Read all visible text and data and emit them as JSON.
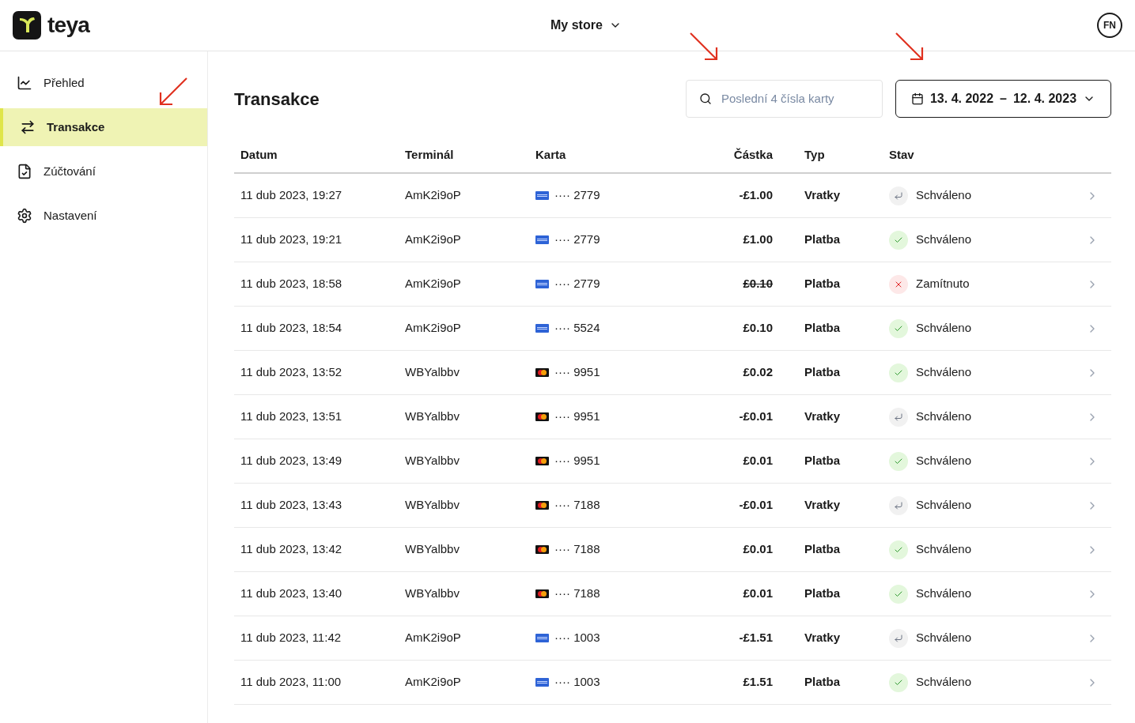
{
  "header": {
    "logo_text": "teya",
    "store": "My store",
    "avatar": "FN"
  },
  "sidebar": {
    "items": [
      {
        "label": "Přehled",
        "selected": false
      },
      {
        "label": "Transakce",
        "selected": true
      },
      {
        "label": "Zúčtování",
        "selected": false
      },
      {
        "label": "Nastavení",
        "selected": false
      }
    ]
  },
  "page": {
    "title": "Transakce",
    "search": {
      "placeholder": "Poslední 4 čísla karty"
    },
    "date_range": {
      "from": "13. 4. 2022",
      "separator": "–",
      "to": "12. 4. 2023"
    }
  },
  "table": {
    "columns": [
      "Datum",
      "Terminál",
      "Karta",
      "Částka",
      "Typ",
      "Stav"
    ],
    "rows": [
      {
        "date": "11 dub 2023, 19:27",
        "terminal": "AmK2i9oP",
        "card": {
          "kind": "amex",
          "number": "···· 2779"
        },
        "amount": "-£1.00",
        "type": "Vratky",
        "status": {
          "kind": "refund",
          "label": "Schváleno"
        }
      },
      {
        "date": "11 dub 2023, 19:21",
        "terminal": "AmK2i9oP",
        "card": {
          "kind": "amex",
          "number": "···· 2779"
        },
        "amount": "£1.00",
        "type": "Platba",
        "status": {
          "kind": "approved",
          "label": "Schváleno"
        }
      },
      {
        "date": "11 dub 2023, 18:58",
        "terminal": "AmK2i9oP",
        "card": {
          "kind": "amex",
          "number": "···· 2779"
        },
        "amount": "£0.10",
        "type": "Platba",
        "status": {
          "kind": "declined",
          "label": "Zamítnuto"
        }
      },
      {
        "date": "11 dub 2023, 18:54",
        "terminal": "AmK2i9oP",
        "card": {
          "kind": "amex",
          "number": "···· 5524"
        },
        "amount": "£0.10",
        "type": "Platba",
        "status": {
          "kind": "approved",
          "label": "Schváleno"
        }
      },
      {
        "date": "11 dub 2023, 13:52",
        "terminal": "WBYalbbv",
        "card": {
          "kind": "mastercard",
          "number": "···· 9951"
        },
        "amount": "£0.02",
        "type": "Platba",
        "status": {
          "kind": "approved",
          "label": "Schváleno"
        }
      },
      {
        "date": "11 dub 2023, 13:51",
        "terminal": "WBYalbbv",
        "card": {
          "kind": "mastercard",
          "number": "···· 9951"
        },
        "amount": "-£0.01",
        "type": "Vratky",
        "status": {
          "kind": "refund",
          "label": "Schváleno"
        }
      },
      {
        "date": "11 dub 2023, 13:49",
        "terminal": "WBYalbbv",
        "card": {
          "kind": "mastercard",
          "number": "···· 9951"
        },
        "amount": "£0.01",
        "type": "Platba",
        "status": {
          "kind": "approved",
          "label": "Schváleno"
        }
      },
      {
        "date": "11 dub 2023, 13:43",
        "terminal": "WBYalbbv",
        "card": {
          "kind": "mastercard",
          "number": "···· 7188"
        },
        "amount": "-£0.01",
        "type": "Vratky",
        "status": {
          "kind": "refund",
          "label": "Schváleno"
        }
      },
      {
        "date": "11 dub 2023, 13:42",
        "terminal": "WBYalbbv",
        "card": {
          "kind": "mastercard",
          "number": "···· 7188"
        },
        "amount": "£0.01",
        "type": "Platba",
        "status": {
          "kind": "approved",
          "label": "Schváleno"
        }
      },
      {
        "date": "11 dub 2023, 13:40",
        "terminal": "WBYalbbv",
        "card": {
          "kind": "mastercard",
          "number": "···· 7188"
        },
        "amount": "£0.01",
        "type": "Platba",
        "status": {
          "kind": "approved",
          "label": "Schváleno"
        }
      },
      {
        "date": "11 dub 2023, 11:42",
        "terminal": "AmK2i9oP",
        "card": {
          "kind": "amex",
          "number": "···· 1003"
        },
        "amount": "-£1.51",
        "type": "Vratky",
        "status": {
          "kind": "refund",
          "label": "Schváleno"
        }
      },
      {
        "date": "11 dub 2023, 11:00",
        "terminal": "AmK2i9oP",
        "card": {
          "kind": "amex",
          "number": "···· 1003"
        },
        "amount": "£1.51",
        "type": "Platba",
        "status": {
          "kind": "approved",
          "label": "Schváleno"
        }
      }
    ]
  }
}
